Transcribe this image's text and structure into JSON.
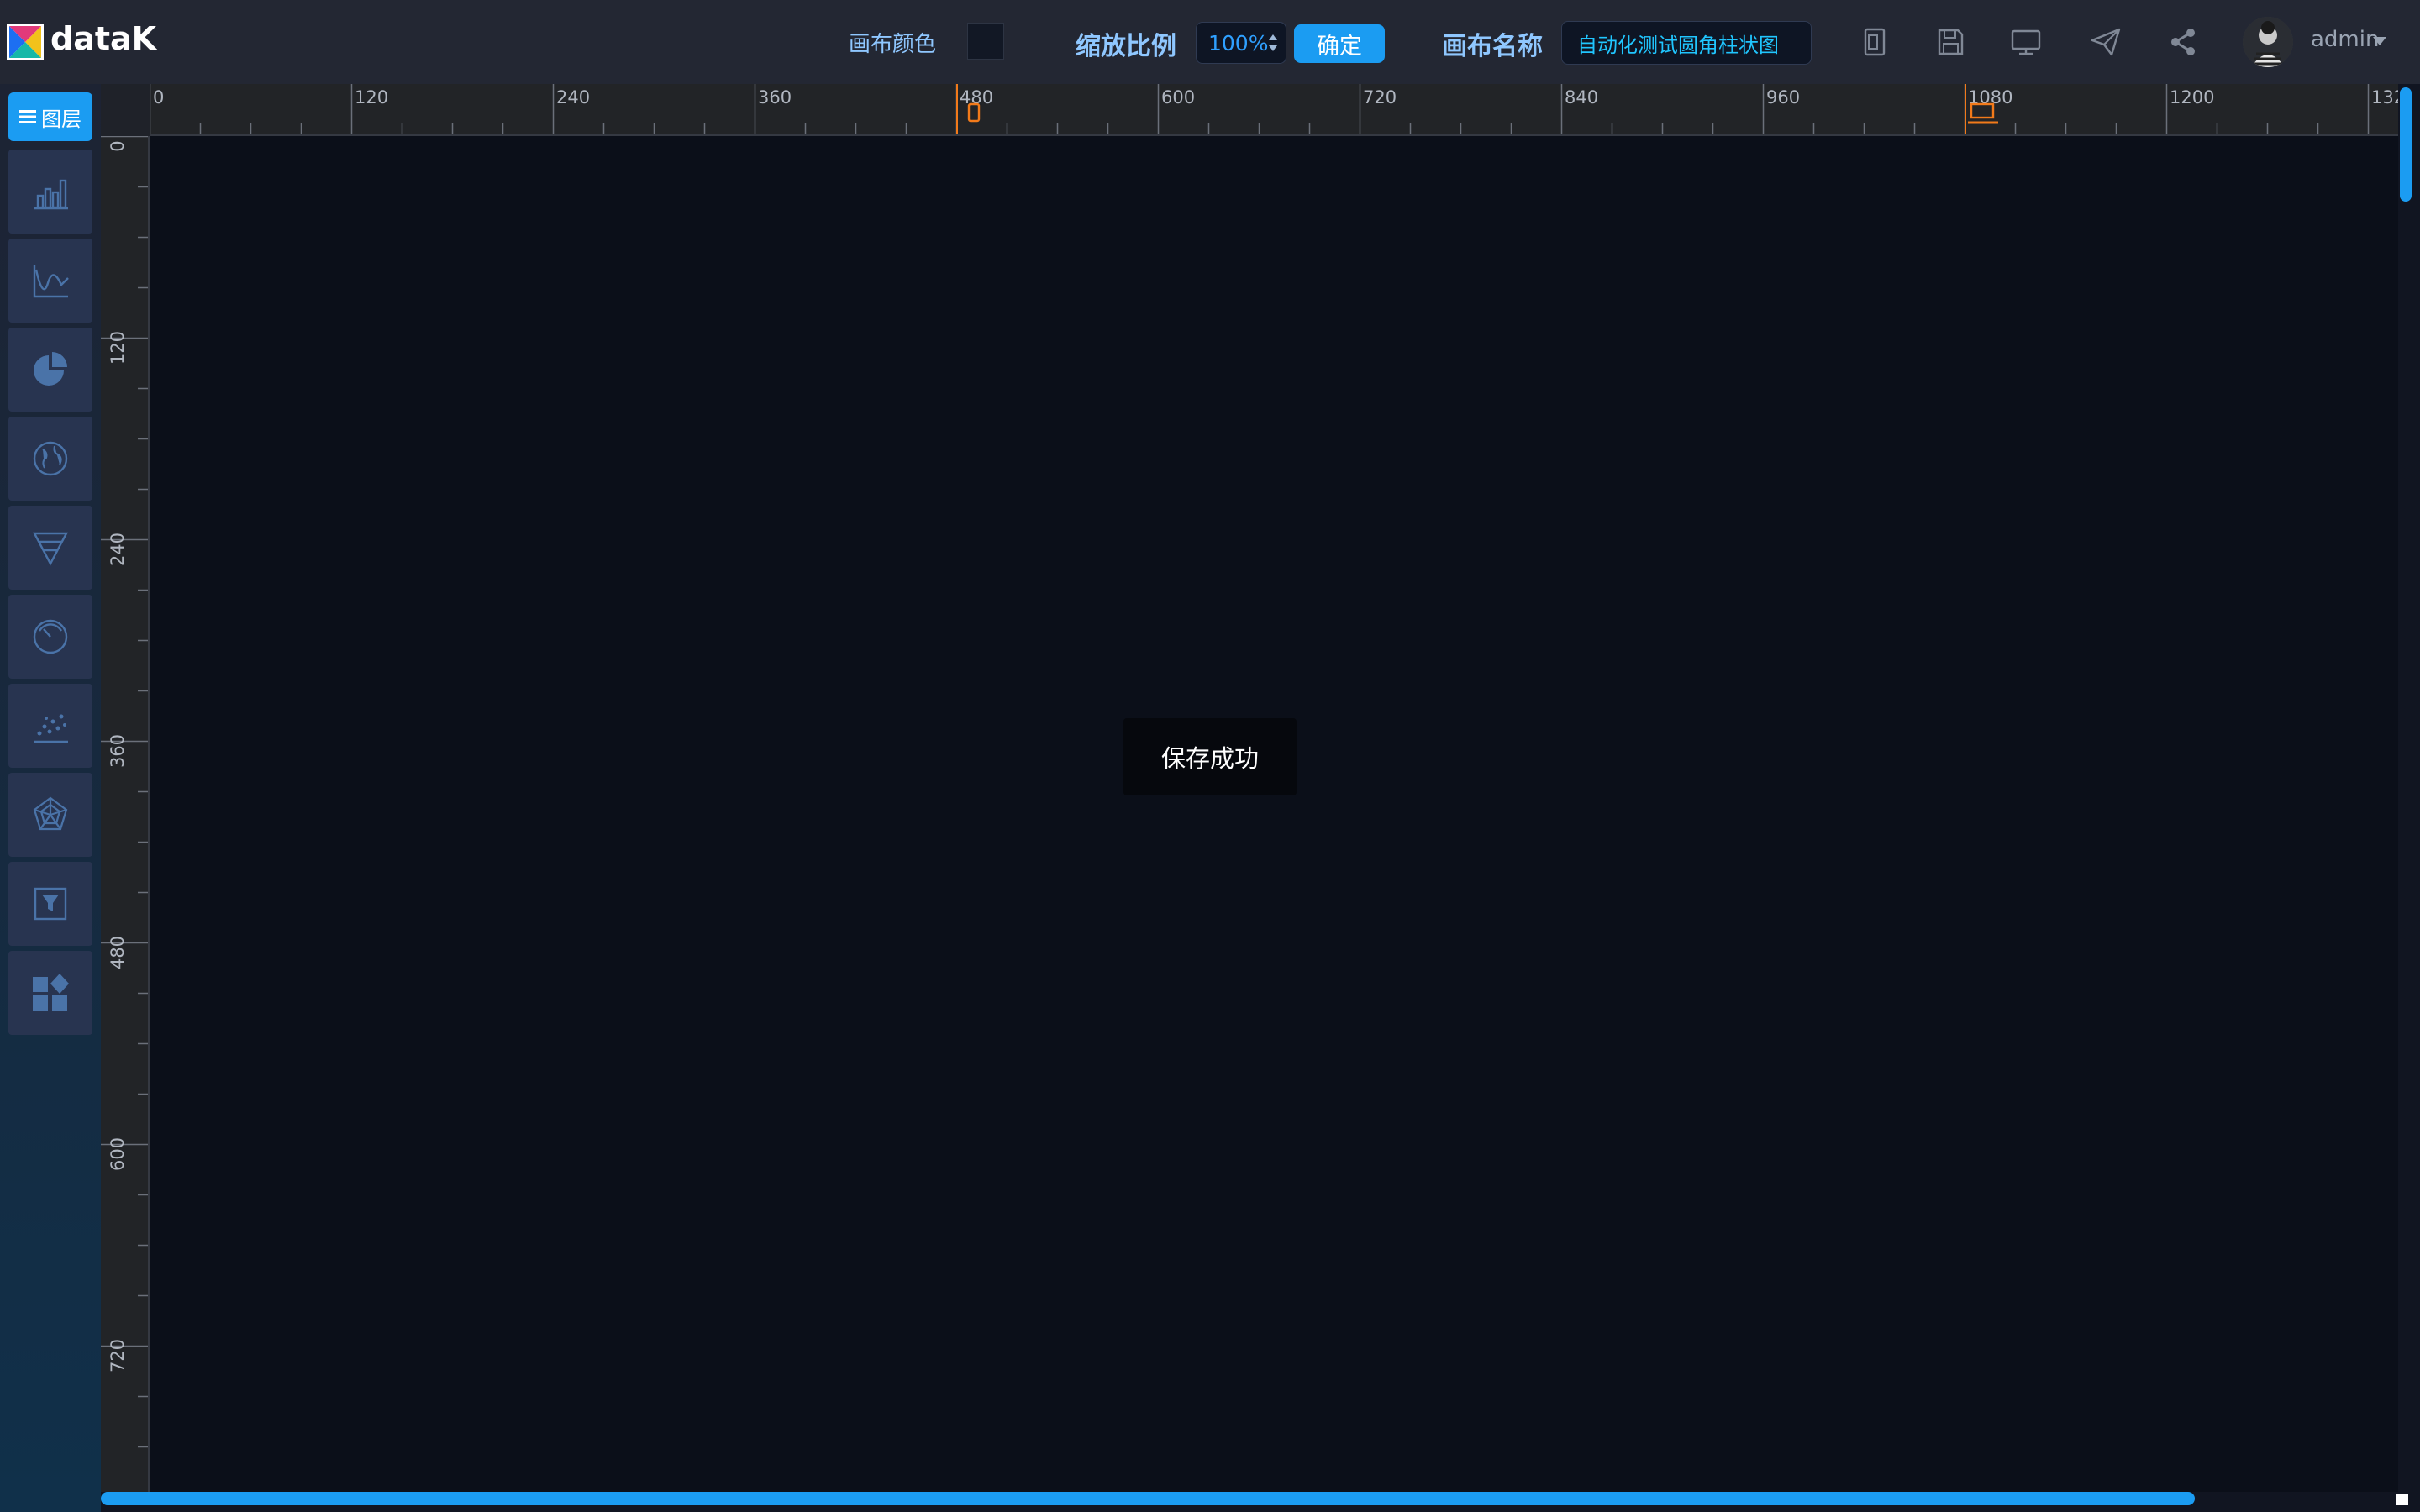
{
  "app": {
    "brand": "dataK"
  },
  "toolbar": {
    "canvas_color_label": "画布颜色",
    "canvas_color_value": "#121825",
    "zoom_label": "缩放比例",
    "zoom_value": "100%",
    "confirm_label": "确定",
    "canvas_name_label": "画布名称",
    "canvas_name_value": "自动化测试圆角柱状图",
    "icons": [
      "mobile-preview-icon",
      "save-icon",
      "desktop-preview-icon",
      "publish-icon",
      "share-icon"
    ]
  },
  "user": {
    "name": "admin"
  },
  "sidebar": {
    "layers_label": "图层",
    "tiles": [
      "bar-chart-icon",
      "line-chart-icon",
      "pie-chart-icon",
      "map-globe-icon",
      "funnel-icon",
      "gauge-icon",
      "scatter-icon",
      "radar-icon",
      "filter-icon",
      "widgets-icon"
    ]
  },
  "ruler": {
    "top_ticks": [
      "0",
      "120",
      "240",
      "360",
      "480",
      "600",
      "720",
      "840",
      "960",
      "1080",
      "1200",
      "132"
    ],
    "left_ticks": [
      "0",
      "120",
      "240",
      "360",
      "480",
      "600",
      "720"
    ]
  },
  "canvas": {
    "toast_text": "保存成功"
  },
  "colors": {
    "accent": "#1b9cf2",
    "topbar_bg": "#232733",
    "canvas_bg": "#0b0f19",
    "marker": "#f27a1a"
  }
}
